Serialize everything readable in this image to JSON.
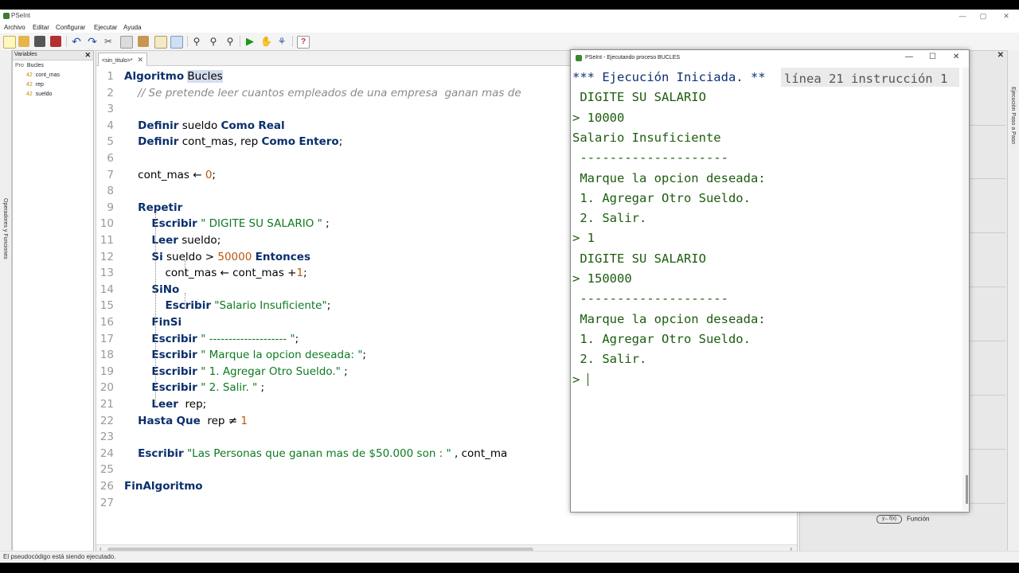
{
  "app": {
    "title": "PSeInt",
    "window_controls": [
      "—",
      "▢",
      "✕"
    ]
  },
  "menu": [
    "Archivo",
    "Editar",
    "Configurar",
    "Ejecutar",
    "Ayuda"
  ],
  "variables_panel": {
    "title": "Variables",
    "close": "✕",
    "root": "Bucles",
    "root_prefix": "Pro",
    "items": [
      {
        "badge": "42",
        "name": "cont_mas"
      },
      {
        "badge": "42",
        "name": "rep"
      },
      {
        "badge": "42",
        "name": "sueldo"
      }
    ]
  },
  "left_tab_label": "Operadores y Funciones",
  "right_tab_label": "Ejecución Paso a Paso",
  "editor": {
    "tab_label": "<sin_titulo>*",
    "tab_close": "✕",
    "lines": [
      "Algoritmo Bucles",
      "    // Se pretende leer cuantos empleados de una empresa  ganan mas de",
      "",
      "    Definir sueldo Como Real",
      "    Definir cont_mas, rep Como Entero;",
      "",
      "    cont_mas ← 0;",
      "",
      "    Repetir",
      "        Escribir \" DIGITE SU SALARIO \" ;",
      "        Leer sueldo;",
      "        Si sueldo > 50000 Entonces",
      "            cont_mas ← cont_mas +1;",
      "        SiNo",
      "            Escribir \"Salario Insuficiente\";",
      "        FinSi",
      "        Escribir \" -------------------- \";",
      "        Escribir \" Marque la opcion deseada: \";",
      "        Escribir \" 1. Agregar Otro Sueldo.\" ;",
      "        Escribir \" 2. Salir. \" ;",
      "        Leer  rep;",
      "    Hasta Que  rep ≠ 1",
      "",
      "    Escribir \"Las Personas que ganan mas de $50.000 son : \" , cont_ma",
      "",
      "FinAlgoritmo",
      ""
    ]
  },
  "right_panel": {
    "function_label": "Función",
    "function_icon_text": "y←f(x)",
    "close": "✕"
  },
  "status": "El pseudocódigo está siendo ejecutado.",
  "exec_window": {
    "title": "PSeInt - Ejecutando proceso BUCLES",
    "controls": [
      "—",
      "☐",
      "✕"
    ],
    "header": "*** Ejecución Iniciada. **",
    "info": "línea 21 instrucción 1",
    "lines": [
      " DIGITE SU SALARIO",
      "> 10000",
      "Salario Insuficiente",
      " --------------------",
      " Marque la opcion deseada:",
      " 1. Agregar Otro Sueldo.",
      " 2. Salir.",
      "> 1",
      " DIGITE SU SALARIO",
      "> 150000",
      " --------------------",
      " Marque la opcion deseada:",
      " 1. Agregar Otro Sueldo.",
      " 2. Salir.",
      "> "
    ]
  }
}
